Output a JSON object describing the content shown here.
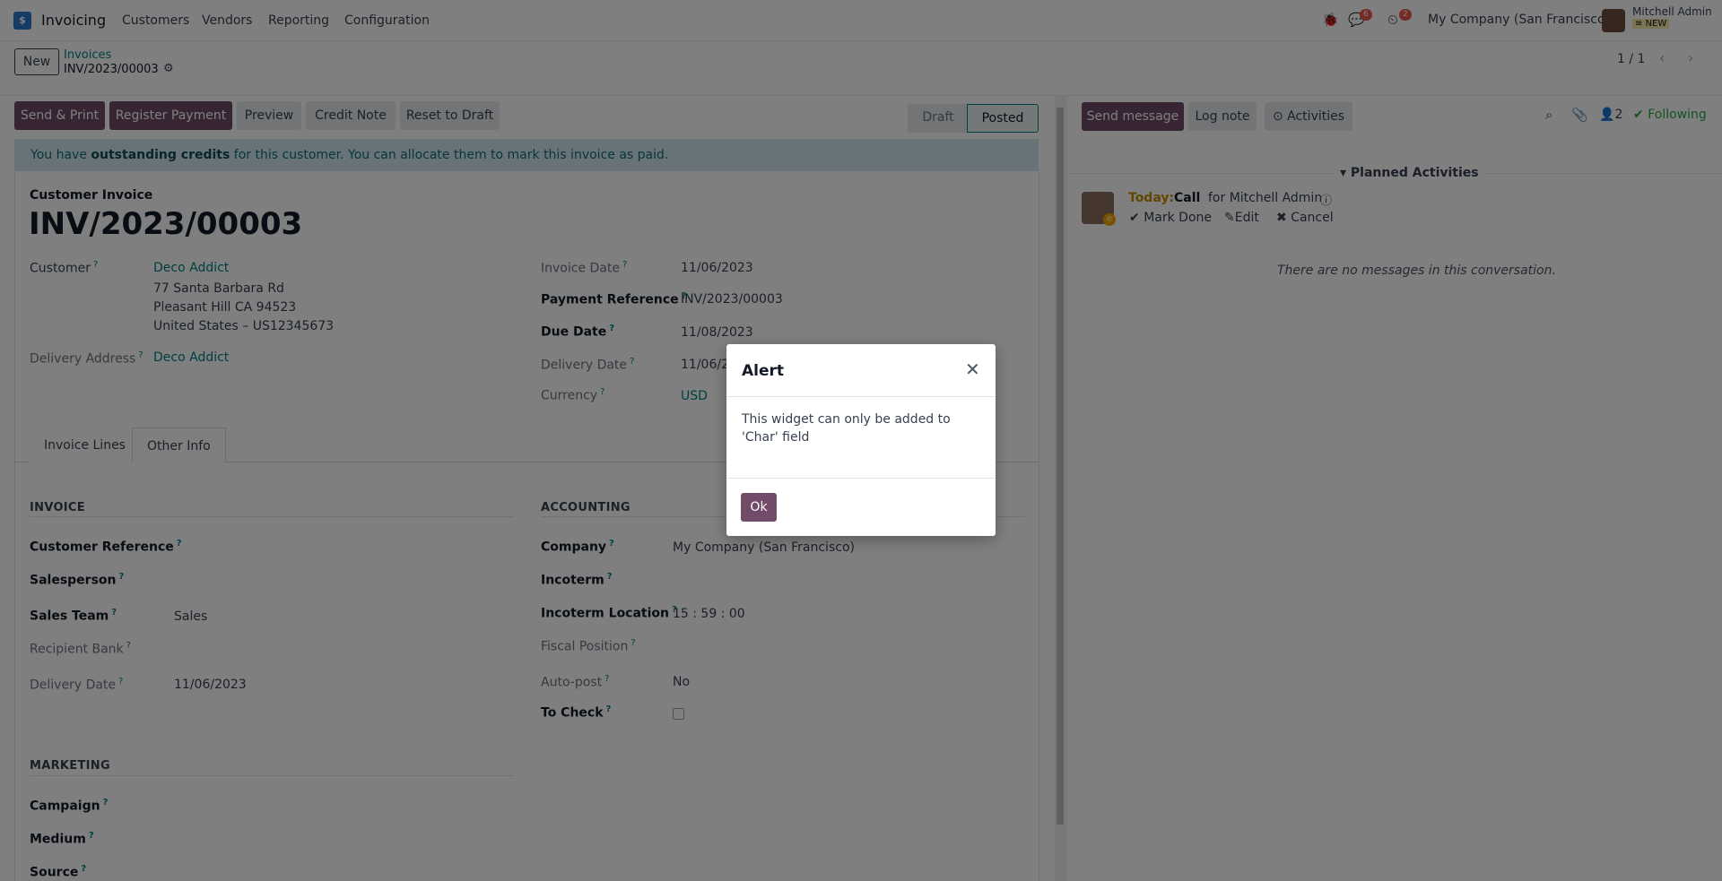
{
  "navbar": {
    "app_name": "Invoicing",
    "menu": [
      "Customers",
      "Vendors",
      "Reporting",
      "Configuration"
    ],
    "messages_count": "6",
    "activities_count": "2",
    "company": "My Company (San Francisco)",
    "user_name": "Mitchell Admin",
    "user_db": "NEW"
  },
  "control_panel": {
    "new_label": "New",
    "breadcrumb_parent": "Invoices",
    "breadcrumb_current": "INV/2023/00003",
    "pager": "1 / 1"
  },
  "actions": {
    "send_print": "Send & Print",
    "register_payment": "Register Payment",
    "preview": "Preview",
    "credit_note": "Credit Note",
    "reset_draft": "Reset to Draft"
  },
  "status": {
    "draft": "Draft",
    "posted": "Posted"
  },
  "banner": {
    "prefix": "You have ",
    "bold": "outstanding credits",
    "suffix": " for this customer. You can allocate them to mark this invoice as paid."
  },
  "invoice": {
    "type_label": "Customer Invoice",
    "number": "INV/2023/00003",
    "customer_label": "Customer",
    "customer": "Deco Addict",
    "address1": "77 Santa Barbara Rd",
    "address2": "Pleasant Hill CA 94523",
    "address3": "United States – US12345673",
    "delivery_address_label": "Delivery Address",
    "delivery_address": "Deco Addict",
    "invoice_date_label": "Invoice Date",
    "invoice_date": "11/06/2023",
    "payment_ref_label": "Payment Reference",
    "payment_ref": "INV/2023/00003",
    "due_date_label": "Due Date",
    "due_date": "11/08/2023",
    "delivery_date_label": "Delivery Date",
    "delivery_date": "11/06/2023",
    "currency_label": "Currency",
    "currency": "USD"
  },
  "tabs": [
    "Invoice Lines",
    "Other Info"
  ],
  "other_info": {
    "invoice_section": "INVOICE",
    "customer_ref_label": "Customer Reference",
    "salesperson_label": "Salesperson",
    "sales_team_label": "Sales Team",
    "sales_team": "Sales",
    "recipient_bank_label": "Recipient Bank",
    "delivery_date_label": "Delivery Date",
    "delivery_date": "11/06/2023",
    "accounting_section": "ACCOUNTING",
    "company_label": "Company",
    "company": "My Company (San Francisco)",
    "incoterm_label": "Incoterm",
    "incoterm_location_label": "Incoterm Location",
    "incoterm_location": "15 : 59 : 00",
    "fiscal_position_label": "Fiscal Position",
    "auto_post_label": "Auto-post",
    "auto_post": "No",
    "to_check_label": "To Check",
    "marketing_section": "MARKETING",
    "campaign_label": "Campaign",
    "medium_label": "Medium",
    "source_label": "Source"
  },
  "chatter": {
    "send_message": "Send message",
    "log_note": "Log note",
    "activities": "Activities",
    "followers_count": "2",
    "following": "Following",
    "planned_activities": "Planned Activities",
    "today": "Today:",
    "activity_type": "Call",
    "activity_for": "for Mitchell Admin",
    "mark_done": "Mark Done",
    "edit": "Edit",
    "cancel": "Cancel",
    "no_messages": "There are no messages in this conversation."
  },
  "modal": {
    "title": "Alert",
    "body": "This widget can only be added to 'Char' field",
    "ok": "Ok"
  }
}
